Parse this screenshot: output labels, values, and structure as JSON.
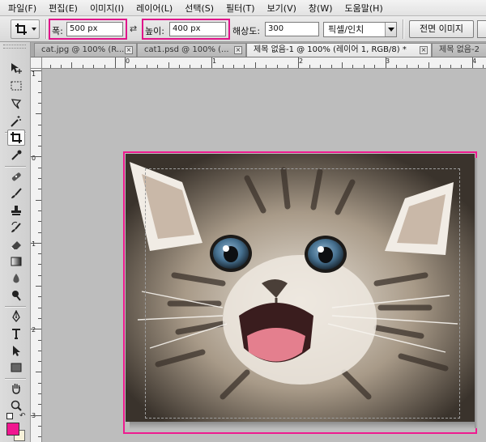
{
  "menu": [
    "파일(F)",
    "편집(E)",
    "이미지(I)",
    "레이어(L)",
    "선택(S)",
    "필터(T)",
    "보기(V)",
    "창(W)",
    "도움말(H)"
  ],
  "options": {
    "width_label": "폭:",
    "width_value": "500 px",
    "height_label": "높이:",
    "height_value": "400 px",
    "resolution_label": "해상도:",
    "resolution_value": "300",
    "resolution_unit": "픽셀/인치",
    "front_image_button": "전면 이미지",
    "highlight_color": "#e0158a"
  },
  "tabs": [
    {
      "label": "cat.jpg @ 100% (R...",
      "close": "☒"
    },
    {
      "label": "cat1.psd @ 100% (...",
      "close": "☒"
    },
    {
      "label": "제목 없음-1 @ 100% (레이어 1, RGB/8) *",
      "close": "☒"
    },
    {
      "label": "제목 없음-2",
      "close": ""
    }
  ],
  "ruler_h_labels": [
    "0",
    "1",
    "2",
    "3",
    "4"
  ],
  "ruler_v_labels": [
    "1",
    "0",
    "1",
    "2",
    "3"
  ],
  "tools": [
    "move-tool",
    "marquee-tool",
    "lasso-tool",
    "quick-select-tool",
    "crop-tool",
    "eyedropper-tool",
    "healing-brush-tool",
    "brush-tool",
    "clone-stamp-tool",
    "history-brush-tool",
    "eraser-tool",
    "gradient-tool",
    "blur-tool",
    "dodge-tool",
    "pen-tool",
    "type-tool",
    "path-select-tool",
    "shape-tool",
    "hand-tool",
    "zoom-tool"
  ],
  "colors": {
    "foreground": "#f0168f",
    "background": "#f7f2d9",
    "document_border": "#ee1b8f"
  }
}
